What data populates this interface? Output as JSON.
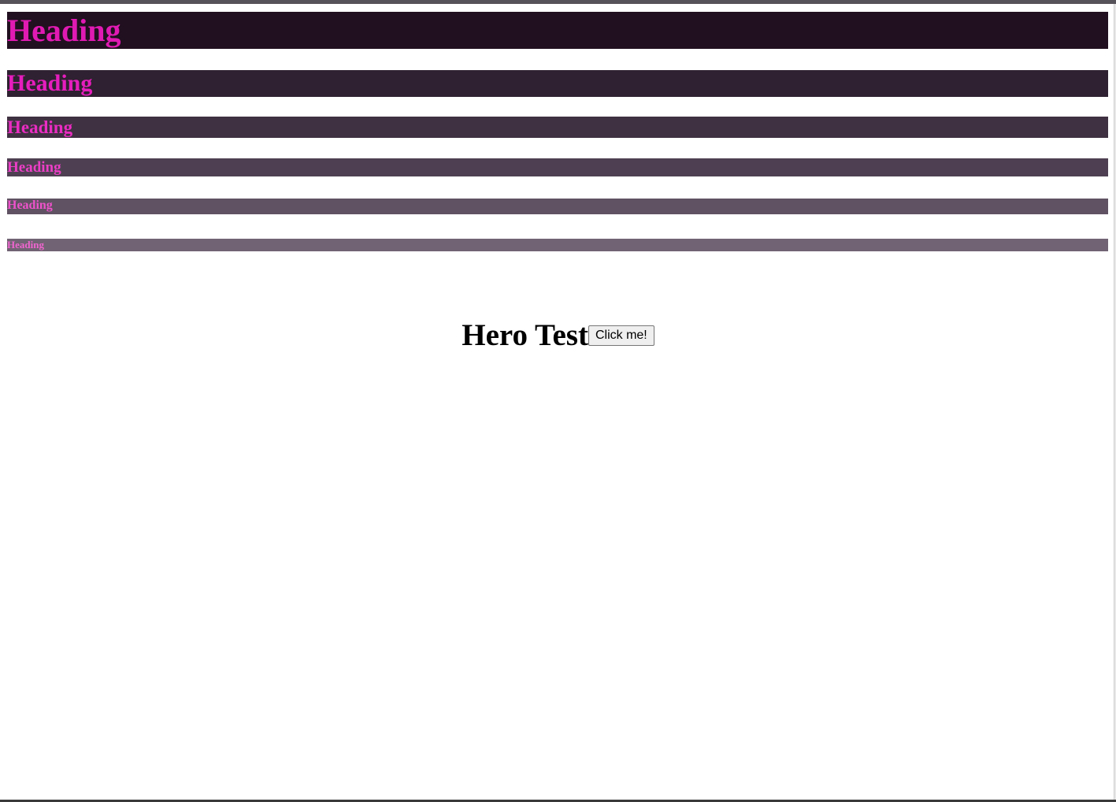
{
  "headings": [
    {
      "text": "Heading",
      "color": "#e01ab3",
      "background": "#211020"
    },
    {
      "text": "Heading",
      "color": "#e61dbd",
      "background": "#2f2131"
    },
    {
      "text": "Heading",
      "color": "#ea2cc2",
      "background": "#3f3141"
    },
    {
      "text": "Heading",
      "color": "#ec3ec6",
      "background": "#4e4052"
    },
    {
      "text": "Heading",
      "color": "#ee52cb",
      "background": "#605262"
    },
    {
      "text": "Heading",
      "color": "#f065cf",
      "background": "#716373"
    }
  ],
  "hero": {
    "title": "Hero Test",
    "button_label": "Click me!"
  }
}
